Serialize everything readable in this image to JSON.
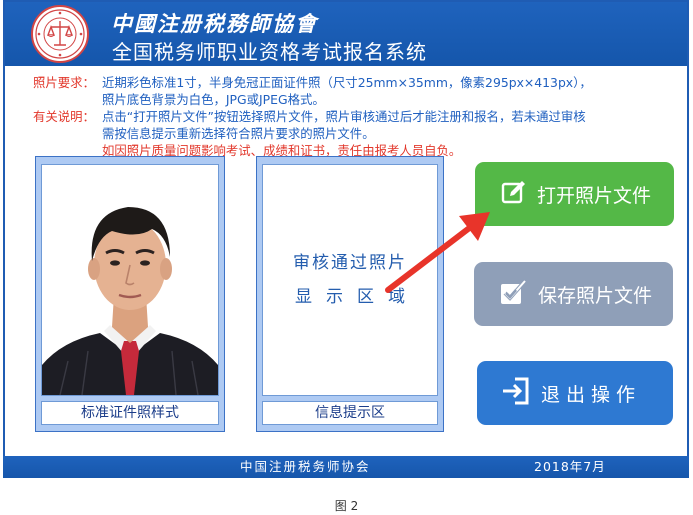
{
  "header": {
    "org_name": "中國注册税務師協會",
    "system_title": "全国税务师职业资格考试报名系统"
  },
  "notes": {
    "photo_req_label": "照片要求：",
    "photo_req_line1": "近期彩色标准1寸，半身免冠正面证件照（尺寸25mm×35mm，像素295px×413px），",
    "photo_req_line2": "照片底色背景为白色，JPG或JPEG格式。",
    "explain_label": "有关说明：",
    "explain_line1": "点击“打开照片文件”按钮选择照片文件，照片审核通过后才能注册和报名，若未通过审核",
    "explain_line2": "需按信息提示重新选择符合照片要求的照片文件。",
    "warning_line": "如因照片质量问题影响考试、成绩和证书，责任由报考人员自负。"
  },
  "sample_panel": {
    "caption": "标准证件照样式"
  },
  "verify_panel": {
    "line1": "审核通过照片",
    "line2": "显示区域",
    "caption": "信息提示区"
  },
  "buttons": {
    "open_label": "打开照片文件",
    "save_label": "保存照片文件",
    "exit_label": "退出操作"
  },
  "footer": {
    "org": "中国注册税务师协会",
    "date": "2018年7月"
  },
  "figure_caption": "图 2",
  "colors": {
    "brand_blue": "#1f63bd",
    "open_green": "#54b847",
    "save_gray": "#8f9fb8",
    "exit_blue": "#2e79d2",
    "warning_red": "#e2382c"
  }
}
